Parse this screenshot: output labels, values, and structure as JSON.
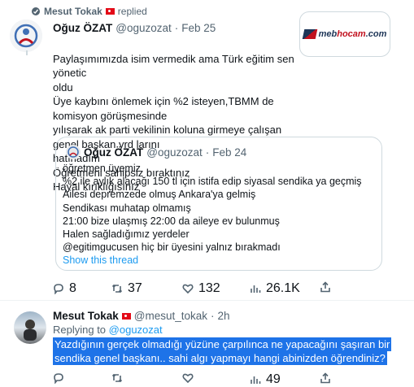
{
  "context": {
    "name": "Mesut Tokak",
    "action": "replied"
  },
  "tweet1": {
    "display_name": "Oğuz ÖZAT",
    "handle": "@oguzozat",
    "sep": "·",
    "date": "Feb 25",
    "text": "Paylaşımımızda isim vermedik ama Türk eğitim sen yönetic\noldu\nÜye kaybını önlemek için %2 isteyen,TBMM de komisyon görüşmesinde\nyılışarak ak parti vekilinin koluna girmeye çalışan genel başkan yrd larını\nhatırladım\nÖğretmeni sahipsiz bıraktınız\nHayal kırıklığısınız",
    "media_logo": {
      "prefix": "meb",
      "brand": "hocam",
      "suffix": ".com"
    }
  },
  "quote": {
    "display_name": "Oğuz ÖZAT",
    "handle": "@oguzozat",
    "sep": "·",
    "date": "Feb 24",
    "text": "öğretmen üyemiz\n%2 ile aylık alacağı 150 tl için istifa edip siyasal sendika ya geçmiş\nAilesi depremzede olmuş Ankara'ya gelmiş\nSendikası muhatap olmamış\n 21:00 bize ulaşmış 22:00 da aileye ev bulunmuş\nHalen sağladığımız yerdeler\n@egitimgucusen hiç bir üyesini yalnız bırakmadı",
    "show_thread": "Show this thread"
  },
  "actions1": {
    "replies": "8",
    "retweets": "37",
    "likes": "132",
    "views": "26.1K"
  },
  "tweet2": {
    "display_name": "Mesut Tokak",
    "handle": "@mesut_tokak",
    "sep": "·",
    "date": "2h",
    "replying_prefix": "Replying to",
    "replying_to": "@oguzozat",
    "line1": "Yazdığının gerçek olmadığı yüzüne çarpılınca ne yapacağını şaşıran bir",
    "line2": "sendika genel başkanı.. sahi algı yapmayı hangi abinizden öğrendiniz?"
  },
  "actions2": {
    "replies": "",
    "retweets": "",
    "likes": "",
    "views": "49"
  },
  "colors": {
    "accent": "#1d9bf0",
    "highlight": "#1e73e8",
    "muted": "#536471"
  }
}
